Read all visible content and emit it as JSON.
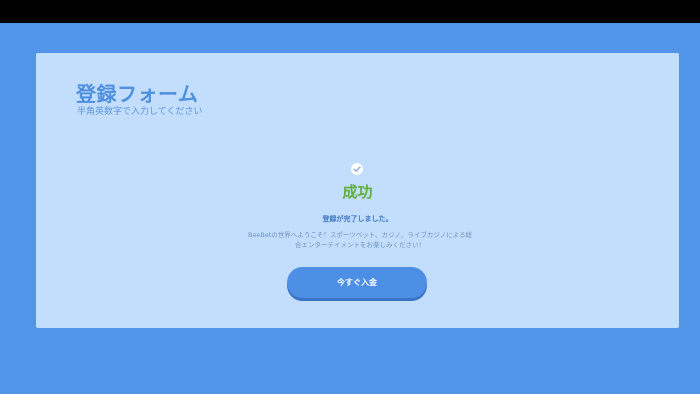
{
  "form": {
    "title": "登録フォーム",
    "subtitle": "半角英数字で入力してください"
  },
  "result": {
    "icon": "check-circle-icon",
    "status": "成功",
    "status_color": "#5fae3c",
    "message": "登録が完了しました。",
    "description": "BeeBetの世界へようこそ！スポーツベット、カジノ、ライブカジノによる総合エンターテイメントをお楽しみください！"
  },
  "actions": {
    "deposit_label": "今すぐ入金"
  },
  "colors": {
    "background": "#5295e8",
    "card": "#c2defc",
    "accent": "#4d8fe4"
  }
}
